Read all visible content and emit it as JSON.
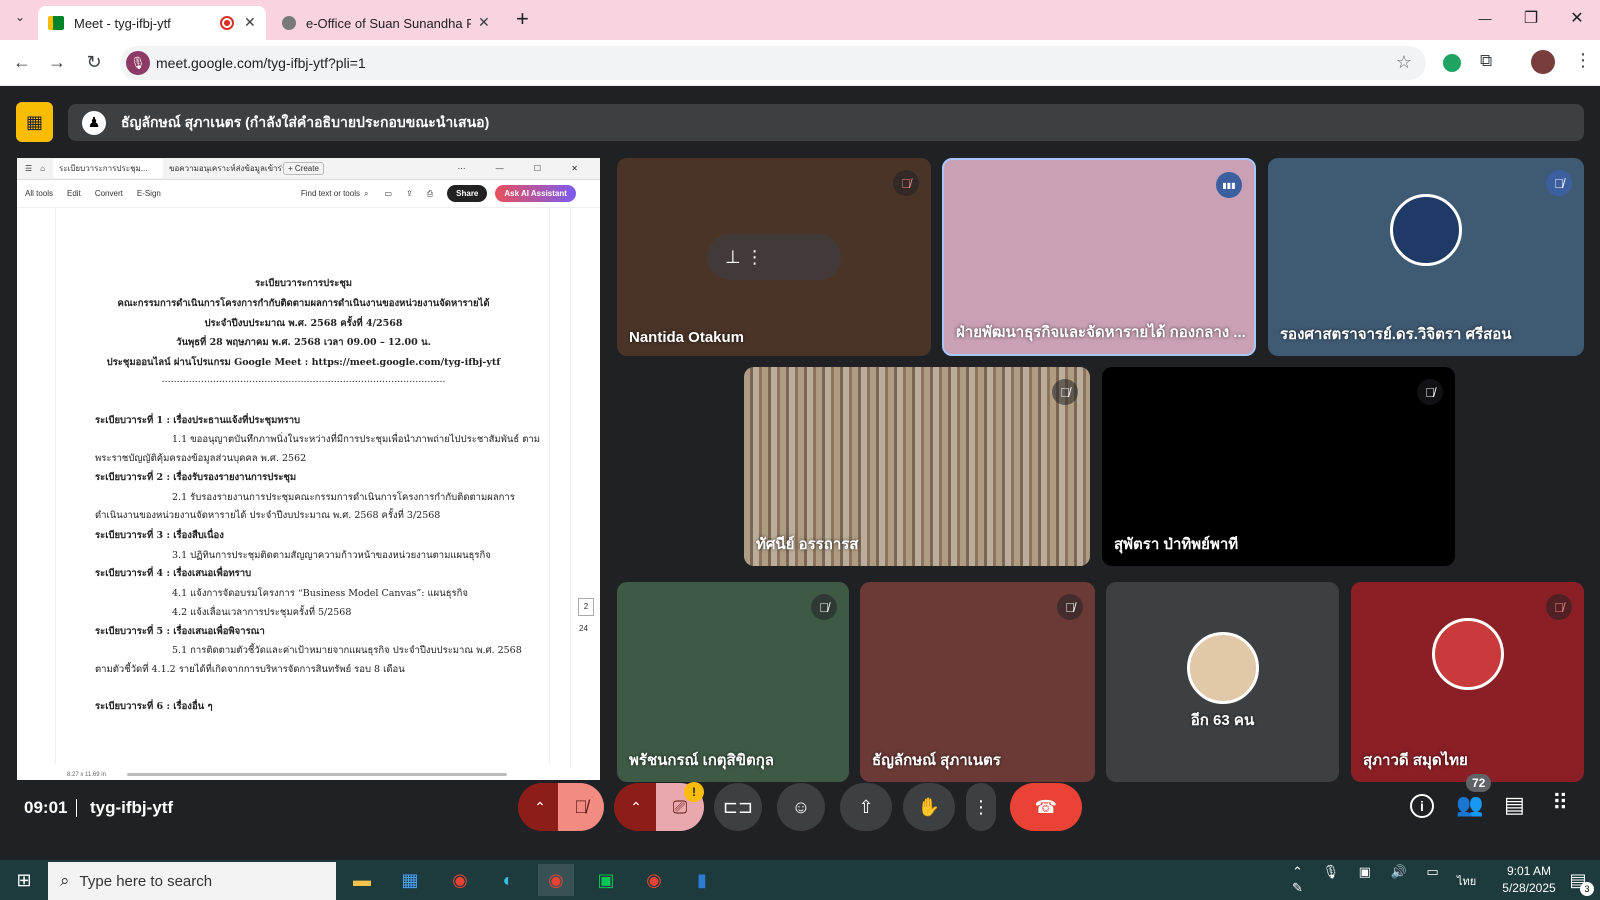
{
  "browser": {
    "tabs": [
      {
        "title": "Meet - tyg-ifbj-ytf",
        "active": true
      },
      {
        "title": "e-Office of Suan Sunandha Raja",
        "active": false
      }
    ],
    "url": "meet.google.com/tyg-ifbj-ytf?pli=1",
    "new_tab": "+",
    "minimize": "—",
    "restore": "❐",
    "close": "✕"
  },
  "presentation": {
    "presenter_text": "ธัญลักษณ์ สุภาเนตร (กำลังใส่คำอธิบายประกอบขณะนำเสนอ)"
  },
  "shared_screen": {
    "tabs": [
      "ระเบียบวาระการประชุม...",
      "ขอความอนุเคราะห์ส่งข้อมูลเข้าร่วม...",
      "+ Create"
    ],
    "menu": [
      "All tools",
      "Edit",
      "Convert",
      "E-Sign"
    ],
    "find_text": "Find text or tools",
    "share_label": "Share",
    "ai_label": "Ask AI Assistant",
    "page_number": "2",
    "page_total": "24",
    "page_size": "8.27 x 11.69 in",
    "doc_lines": [
      {
        "text": "ระเบียบวาระการประชุม",
        "bold": true,
        "center": true
      },
      {
        "text": "คณะกรรมการดำเนินการโครงการกำกับติดตามผลการดำเนินงานของหน่วยงานจัดหารายได้",
        "bold": true,
        "center": true
      },
      {
        "text": "ประจำปีงบประมาณ พ.ศ. 2568 ครั้งที่ 4/2568",
        "bold": true,
        "center": true
      },
      {
        "text": "วันพุธที่ 28 พฤษภาคม พ.ศ. 2568 เวลา 09.00 – 12.00 น.",
        "bold": true,
        "center": true
      },
      {
        "text": "ประชุมออนไลน์ ผ่านโปรแกรม Google Meet : https://meet.google.com/tyg-ifbj-ytf",
        "bold": true,
        "center": true
      },
      {
        "text": "..............................................................................................",
        "bold": false,
        "center": true
      },
      {
        "text": "ระเบียบวาระที่ 1 : เรื่องประธานแจ้งที่ประชุมทราบ",
        "bold": true,
        "center": false
      },
      {
        "text": "1.1 ขออนุญาตบันทึกภาพนิ่งในระหว่างที่มีการประชุมเพื่อนำภาพถ่ายไปประชาสัมพันธ์ ตาม",
        "bold": false,
        "center": false
      },
      {
        "text": "พระราชบัญญัติคุ้มครองข้อมูลส่วนบุคคล พ.ศ. 2562",
        "bold": false,
        "center": false
      },
      {
        "text": "ระเบียบวาระที่ 2 : เรื่องรับรองรายงานการประชุม",
        "bold": true,
        "center": false
      },
      {
        "text": "2.1 รับรองรายงานการประชุมคณะกรรมการดำเนินการโครงการกำกับติดตามผลการ",
        "bold": false,
        "center": false
      },
      {
        "text": "ดำเนินงานของหน่วยงานจัดหารายได้ ประจำปีงบประมาณ พ.ศ. 2568 ครั้งที่ 3/2568",
        "bold": false,
        "center": false
      },
      {
        "text": "ระเบียบวาระที่ 3 : เรื่องสืบเนื่อง",
        "bold": true,
        "center": false
      },
      {
        "text": "3.1 ปฏิทินการประชุมติดตามสัญญาความก้าวหน้าของหน่วยงานตามแผนธุรกิจ",
        "bold": false,
        "center": false
      },
      {
        "text": "ระเบียบวาระที่ 4 : เรื่องเสนอเพื่อทราบ",
        "bold": true,
        "center": false
      },
      {
        "text": "4.1 แจ้งการจัดอบรมโครงการ “Business Model Canvas”: แผนธุรกิจ",
        "bold": false,
        "center": false
      },
      {
        "text": "4.2 แจ้งเลื่อนเวลาการประชุมครั้งที่ 5/2568",
        "bold": false,
        "center": false
      },
      {
        "text": "ระเบียบวาระที่ 5 : เรื่องเสนอเพื่อพิจารณา",
        "bold": true,
        "center": false
      },
      {
        "text": "5.1 การติดตามตัวชี้วัดและค่าเป้าหมายจากแผนธุรกิจ ประจำปีงบประมาณ พ.ศ. 2568",
        "bold": false,
        "center": false
      },
      {
        "text": "ตามตัวชี้วัดที่ 4.1.2  รายได้ที่เกิดจากการบริหารจัดการสินทรัพย์ รอบ 8 เดือน",
        "bold": false,
        "center": false
      },
      {
        "text": "ระเบียบวาระที่ 6 : เรื่องอื่น ๆ",
        "bold": true,
        "center": false
      }
    ]
  },
  "participants": [
    {
      "name": "Nantida Otakum",
      "bg": "#4a3428"
    },
    {
      "name": "ฝ่ายพัฒนาธุรกิจและจัดหารายได้ กองกลาง ...",
      "bg": "#c9a0b4"
    },
    {
      "name": "รองศาสตราจารย์.ดร.วิจิตรา ศรีสอน",
      "bg": "#3f5a73"
    },
    {
      "name": "ทัศนีย์ อรรถารส",
      "bg": "#8c7b66"
    },
    {
      "name": "สุพัตรา ป่าทิพย์พาที",
      "bg": "#000000"
    },
    {
      "name": "พรัชนกรณ์ เกตุสิขิตกุล",
      "bg": "#3e5a45"
    },
    {
      "name": "ธัญลักษณ์ สุภาเนตร",
      "bg": "#6b3a36"
    },
    {
      "name": "อีก 63 คน",
      "bg": "#3c4043"
    },
    {
      "name": "สุภาวดี สมุดไทย",
      "bg": "#8a1f26"
    }
  ],
  "meeting": {
    "time": "09:01",
    "code": "tyg-ifbj-ytf",
    "participant_count": "72",
    "warning": "!"
  },
  "taskbar": {
    "search_placeholder": "Type here to search",
    "language": "ไทย",
    "clock_time": "9:01 AM",
    "clock_date": "5/28/2025",
    "notification_count": "3"
  },
  "colors": {
    "accent_red": "#ea4335",
    "mic_off_bg": "#f28b82",
    "cam_off_bg": "#e8a8ad",
    "presenter_yellow": "#fbbc04"
  }
}
